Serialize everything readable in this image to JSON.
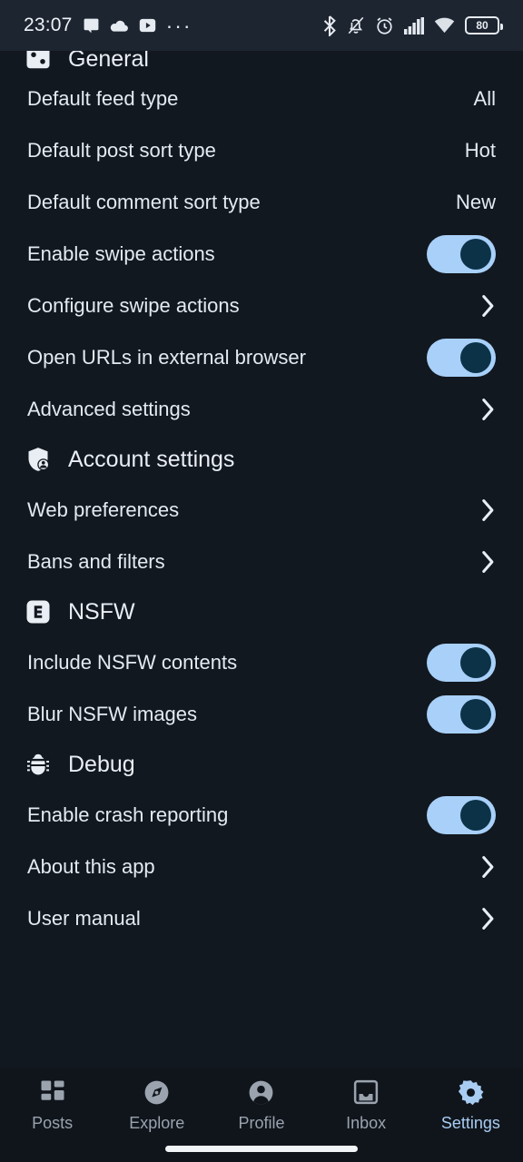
{
  "status_bar": {
    "time": "23:07",
    "left_icons": [
      "chat-bubble-icon",
      "cloud-icon",
      "youtube-icon",
      "more-dots-icon"
    ],
    "right_icons": [
      "bluetooth-icon",
      "notifications-muted-icon",
      "alarm-icon",
      "signal-icon",
      "wifi-icon"
    ],
    "battery_level": "80"
  },
  "colors": {
    "background": "#121820",
    "status_bar_bg": "#1d2531",
    "nav_bg": "#10151c",
    "text_primary": "#e4eaf1",
    "toggle_track_on": "#a8d0f8",
    "toggle_knob_on": "#0c3248",
    "accent": "#a9ccf2",
    "nav_inactive": "#9aa3ae"
  },
  "sections": [
    {
      "id": "general",
      "title": "General",
      "icon": "tune-sliders-icon",
      "clipped": true,
      "rows": [
        {
          "label": "Default feed type",
          "type": "value",
          "value": "All",
          "name": "row-default-feed-type"
        },
        {
          "label": "Default post sort type",
          "type": "value",
          "value": "Hot",
          "name": "row-default-post-sort-type"
        },
        {
          "label": "Default comment sort type",
          "type": "value",
          "value": "New",
          "name": "row-default-comment-sort-type"
        },
        {
          "label": "Enable swipe actions",
          "type": "toggle",
          "on": true,
          "name": "row-enable-swipe-actions"
        },
        {
          "label": "Configure swipe actions",
          "type": "chevron",
          "name": "row-configure-swipe-actions"
        },
        {
          "label": "Open URLs in external browser",
          "type": "toggle",
          "on": true,
          "name": "row-open-urls-external-browser"
        },
        {
          "label": "Advanced settings",
          "type": "chevron",
          "name": "row-advanced-settings"
        }
      ]
    },
    {
      "id": "account-settings",
      "title": "Account settings",
      "icon": "shield-account-icon",
      "clipped": false,
      "rows": [
        {
          "label": "Web preferences",
          "type": "chevron",
          "name": "row-web-preferences"
        },
        {
          "label": "Bans and filters",
          "type": "chevron",
          "name": "row-bans-and-filters"
        }
      ]
    },
    {
      "id": "nsfw",
      "title": "NSFW",
      "icon": "explicit-badge-icon",
      "clipped": false,
      "rows": [
        {
          "label": "Include NSFW contents",
          "type": "toggle",
          "on": true,
          "name": "row-include-nsfw-contents"
        },
        {
          "label": "Blur NSFW images",
          "type": "toggle",
          "on": true,
          "name": "row-blur-nsfw-images"
        }
      ]
    },
    {
      "id": "debug",
      "title": "Debug",
      "icon": "bug-icon",
      "clipped": false,
      "rows": [
        {
          "label": "Enable crash reporting",
          "type": "toggle",
          "on": true,
          "name": "row-enable-crash-reporting"
        },
        {
          "label": "About this app",
          "type": "chevron",
          "name": "row-about-this-app"
        },
        {
          "label": "User manual",
          "type": "chevron",
          "name": "row-user-manual"
        }
      ]
    }
  ],
  "bottom_nav": {
    "items": [
      {
        "label": "Posts",
        "icon": "grid-dashboard-icon",
        "active": false,
        "name": "nav-item-posts"
      },
      {
        "label": "Explore",
        "icon": "compass-icon",
        "active": false,
        "name": "nav-item-explore"
      },
      {
        "label": "Profile",
        "icon": "person-circle-icon",
        "active": false,
        "name": "nav-item-profile"
      },
      {
        "label": "Inbox",
        "icon": "inbox-tray-icon",
        "active": false,
        "name": "nav-item-inbox"
      },
      {
        "label": "Settings",
        "icon": "gear-icon",
        "active": true,
        "name": "nav-item-settings"
      }
    ]
  }
}
